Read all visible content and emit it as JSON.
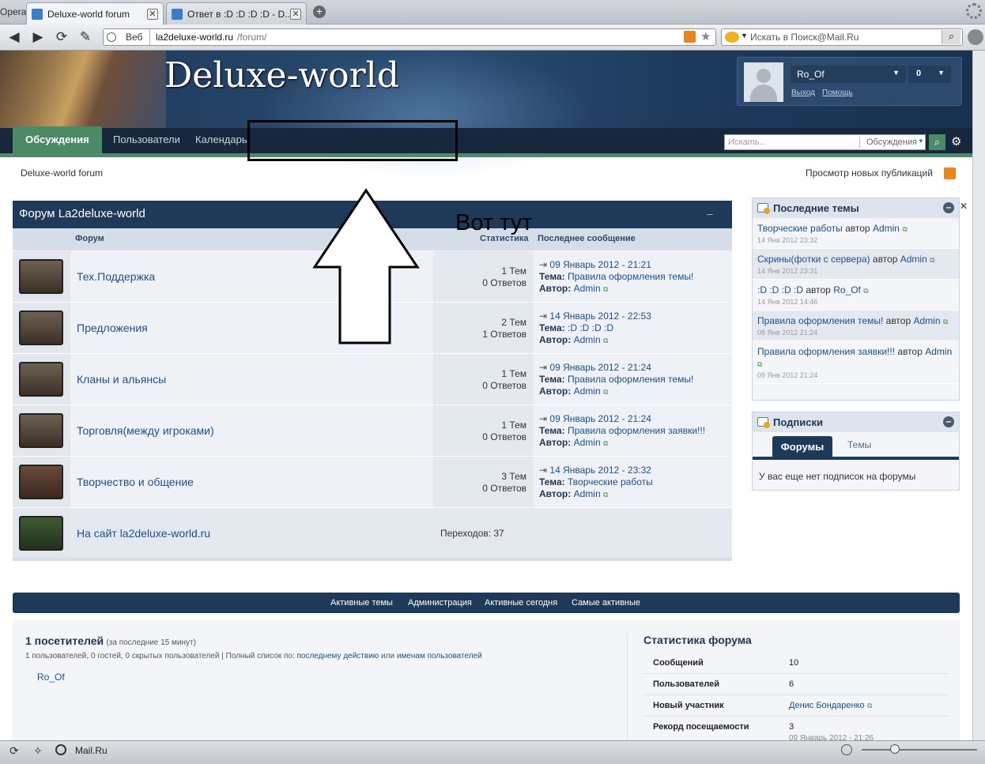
{
  "browser": {
    "app_label": "Opera",
    "tabs": [
      {
        "label": "Deluxe-world forum",
        "active": true
      },
      {
        "label": "Ответ в :D :D :D :D - D...",
        "active": false
      }
    ],
    "web_label": "Веб",
    "url_host": "la2deluxe-world.ru",
    "url_path": "/forum/",
    "search_placeholder": "Искать в Поиск@Mail.Ru",
    "status_label": "Mail.Ru"
  },
  "header": {
    "site_title": "Deluxe-world",
    "user": {
      "name": "Ro_Of",
      "count": "0",
      "logout": "Выход",
      "help": "Помощь"
    },
    "menu": [
      "Обсуждения",
      "Пользователи",
      "Календарь"
    ],
    "search_placeholder": "Искать...",
    "search_scope": "Обсуждения"
  },
  "breadcrumb": "Deluxe-world forum",
  "new_posts_link": "Просмотр новых публикаций",
  "forum": {
    "title": "Форум La2deluxe-world",
    "collapse": "–",
    "col_forum": "Форум",
    "col_stats": "Статистика",
    "col_last": "Последнее сообщение",
    "rows": [
      {
        "name": "Тех.Поддержка",
        "topics": "1 Тем",
        "replies": "0 Ответов",
        "date": "09 Январь 2012 - 21:21",
        "topic_label": "Тема:",
        "topic": "Правила оформления темы!",
        "author_label": "Автор:",
        "author": "Admin"
      },
      {
        "name": "Предложения",
        "topics": "2 Тем",
        "replies": "1 Ответов",
        "date": "14 Январь 2012 - 22:53",
        "topic_label": "Тема:",
        "topic": ":D :D :D :D",
        "author_label": "Автор:",
        "author": "Admin"
      },
      {
        "name": "Кланы и альянсы",
        "topics": "1 Тем",
        "replies": "0 Ответов",
        "date": "09 Январь 2012 - 21:24",
        "topic_label": "Тема:",
        "topic": "Правила оформления темы!",
        "author_label": "Автор:",
        "author": "Admin"
      },
      {
        "name": "Торговля(между игроками)",
        "topics": "1 Тем",
        "replies": "0 Ответов",
        "date": "09 Январь 2012 - 21:24",
        "topic_label": "Тема:",
        "topic": "Правила оформления заявки!!!",
        "author_label": "Автор:",
        "author": "Admin"
      },
      {
        "name": "Творчество и общение",
        "topics": "3 Тем",
        "replies": "0 Ответов",
        "date": "14 Январь 2012 - 23:32",
        "topic_label": "Тема:",
        "topic": "Творческие работы",
        "author_label": "Автор:",
        "author": "Admin"
      }
    ],
    "redirect": {
      "name": "На сайт la2deluxe-world.ru",
      "hits": "Переходов: 37"
    }
  },
  "sidebar": {
    "recent_title": "Последние темы",
    "recent": [
      {
        "title": "Творческие работы",
        "by": "автор",
        "author": "Admin",
        "date": "14 Янв 2012 23:32"
      },
      {
        "title": "Скрины(фотки с сервера)",
        "by": "автор",
        "author": "Admin",
        "date": "14 Янв 2012 23:31"
      },
      {
        "title": ":D :D :D :D",
        "by": "автор",
        "author": "Ro_Of",
        "date": "14 Янв 2012 14:46"
      },
      {
        "title": "Правила оформления темы!",
        "by": "автор",
        "author": "Admin",
        "date": "09 Янв 2012 21:24"
      },
      {
        "title": "Правила оформления заявки!!!",
        "by": "автор",
        "author": "Admin",
        "date": "09 Янв 2012 21:24"
      }
    ],
    "subs_title": "Подписки",
    "subs_tabs": [
      "Форумы",
      "Темы"
    ],
    "subs_empty": "У вас еще нет подписок на форумы"
  },
  "footer": {
    "links": [
      "Активные темы",
      "Администрация",
      "Активные сегодня",
      "Самые активные"
    ],
    "visitors_title": "1 посетителей",
    "visitors_sub": "(за последние 15 минут)",
    "visitors_detail": "1 пользователей, 0 гостей, 0 скрытых пользователей | Полный список по:",
    "visitors_link1": "последнему действию",
    "visitors_or": "или",
    "visitors_link2": "именам пользователей",
    "online_user": "Ro_Of",
    "stats_title": "Статистика форума",
    "stats": [
      {
        "label": "Сообщений",
        "value": "10"
      },
      {
        "label": "Пользователей",
        "value": "6"
      },
      {
        "label": "Новый участник",
        "value": "Денис Бондаренко"
      },
      {
        "label": "Рекорд посещаемости",
        "value": "3"
      }
    ],
    "record_date": "09 Январь 2012 - 21:26"
  },
  "annotation": {
    "text": "Вот тут"
  },
  "colors": {
    "header_dark": "#1c3654",
    "accent_green": "#4b8a66",
    "link": "#1d4f8a"
  }
}
